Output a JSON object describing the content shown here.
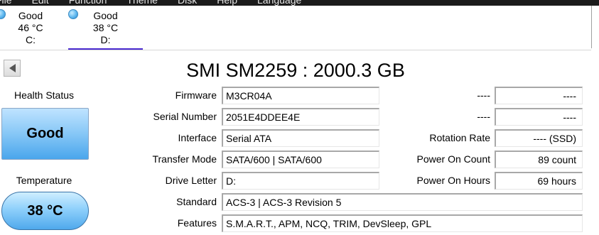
{
  "menu": {
    "items": [
      "File",
      "Edit",
      "Function",
      "Theme",
      "Disk",
      "Help",
      "Language"
    ]
  },
  "drives": [
    {
      "status": "Good",
      "temp": "46 °C",
      "letter": "C:",
      "active": false
    },
    {
      "status": "Good",
      "temp": "38 °C",
      "letter": "D:",
      "active": true
    }
  ],
  "disk_title": "SMI SM2259 : 2000.3 GB",
  "health": {
    "label": "Health Status",
    "value": "Good",
    "color": "#5fb3ef"
  },
  "temperature": {
    "label": "Temperature",
    "value": "38 °C"
  },
  "details": {
    "firmware": {
      "label": "Firmware",
      "value": "M3CR04A"
    },
    "serial": {
      "label": "Serial Number",
      "value": "2051E4DDEE4E"
    },
    "interface": {
      "label": "Interface",
      "value": "Serial ATA"
    },
    "transfer": {
      "label": "Transfer Mode",
      "value": "SATA/600 | SATA/600"
    },
    "drive_letter": {
      "label": "Drive Letter",
      "value": "D:"
    },
    "standard": {
      "label": "Standard",
      "value": "ACS-3 | ACS-3 Revision 5"
    },
    "features": {
      "label": "Features",
      "value": "S.M.A.R.T., APM, NCQ, TRIM, DevSleep, GPL"
    }
  },
  "right_details": {
    "row1": {
      "label": "----",
      "value": "----"
    },
    "row2": {
      "label": "----",
      "value": "----"
    },
    "rotation": {
      "label": "Rotation Rate",
      "value": "---- (SSD)"
    },
    "power_count": {
      "label": "Power On Count",
      "value": "89 count"
    },
    "power_hours": {
      "label": "Power On Hours",
      "value": "69 hours"
    }
  },
  "icons": {
    "back": "left-triangle-icon",
    "drive_status": "blue-circle-icon"
  }
}
